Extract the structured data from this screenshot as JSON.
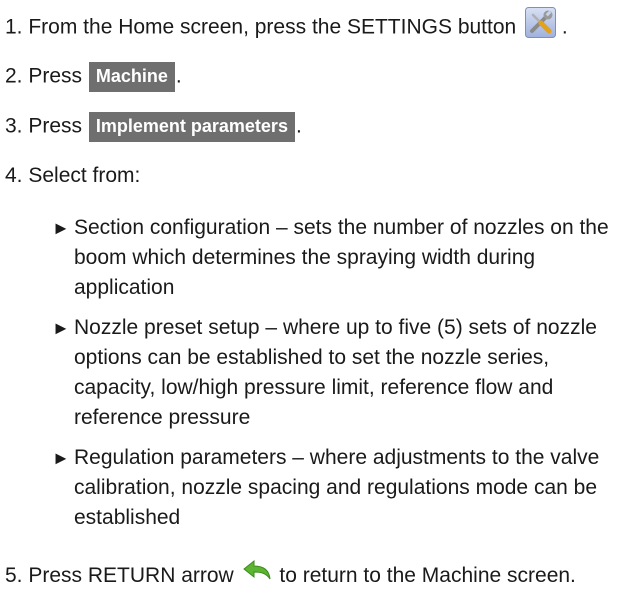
{
  "steps": {
    "s1": {
      "before": "1. From the Home screen, press the SETTINGS button",
      "after": "."
    },
    "s2": {
      "before": "2. Press",
      "button": "Machine",
      "after": "."
    },
    "s3": {
      "before": "3. Press",
      "button": "Implement parameters",
      "after": "."
    },
    "s4": {
      "text": "4. Select from:"
    },
    "s5": {
      "before": "5. Press RETURN arrow",
      "after": "to return to the Machine screen."
    }
  },
  "options": [
    {
      "arrow": "►",
      "text": "Section configuration – sets the number of nozzles on the boom which determines the spraying width during application"
    },
    {
      "arrow": "►",
      "text": "Nozzle preset setup – where up to five (5) sets of nozzle options can be established to set the nozzle series, capacity, low/high pressure limit, reference flow and reference pressure"
    },
    {
      "arrow": "►",
      "text": "Regulation parameters – where adjustments to the valve calibration, nozzle spacing and regulations mode can be established"
    }
  ],
  "icons": {
    "settings": "settings-tools-icon",
    "return": "return-arrow-icon"
  },
  "colors": {
    "ui_button_bg": "#6f6f6f",
    "settings_icon_bg": "#b9c7ea",
    "return_arrow": "#5cb531"
  }
}
